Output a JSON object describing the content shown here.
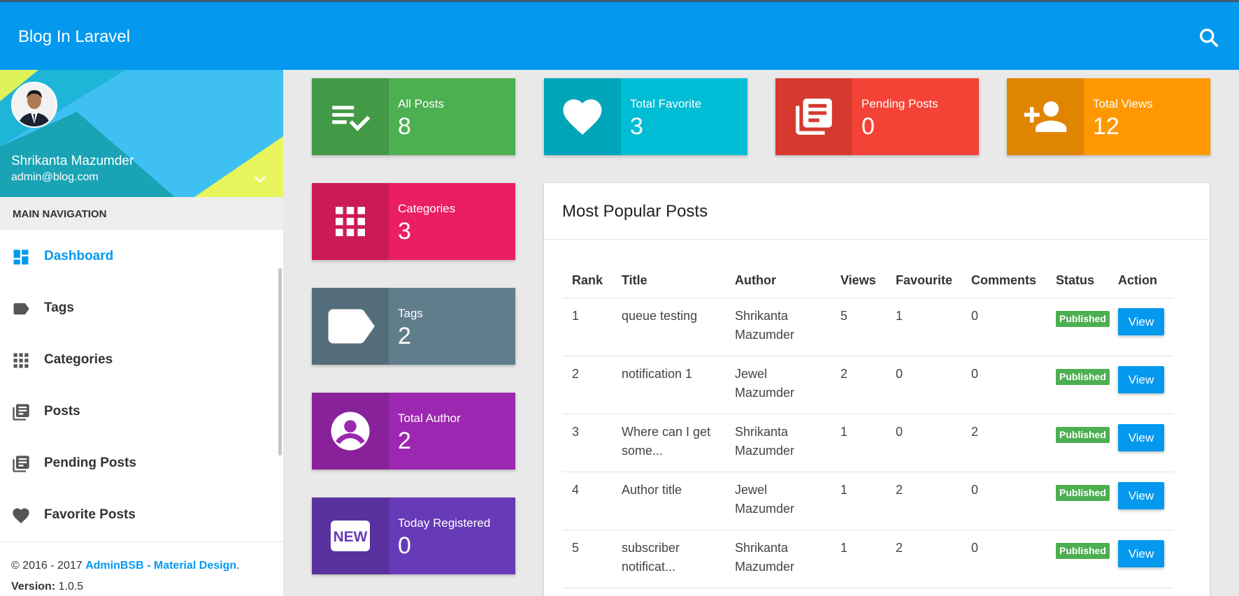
{
  "header": {
    "brand": "Blog In Laravel",
    "search_icon": "search-icon"
  },
  "user": {
    "name": "Shrikanta Mazumder",
    "email": "admin@blog.com"
  },
  "sidebar": {
    "section_header": "MAIN NAVIGATION",
    "items": [
      {
        "label": "Dashboard",
        "icon": "dashboard-icon",
        "active": true
      },
      {
        "label": "Tags",
        "icon": "label-icon",
        "active": false
      },
      {
        "label": "Categories",
        "icon": "apps-grid-icon",
        "active": false
      },
      {
        "label": "Posts",
        "icon": "library-books-icon",
        "active": false
      },
      {
        "label": "Pending Posts",
        "icon": "library-books-icon",
        "active": false
      },
      {
        "label": "Favorite Posts",
        "icon": "heart-icon",
        "active": false
      }
    ],
    "footer": {
      "copyright_prefix": "© 2016 - 2017 ",
      "link": "AdminBSB - Material Design",
      "copyright_suffix": ".",
      "version_label": "Version:",
      "version_value": "1.0.5"
    }
  },
  "stats": [
    {
      "title": "All Posts",
      "value": "8",
      "color": "#4caf50",
      "icon": "playlist-check-icon"
    },
    {
      "title": "Total Favorite",
      "value": "3",
      "color": "#00bcd4",
      "icon": "heart-icon"
    },
    {
      "title": "Pending Posts",
      "value": "0",
      "color": "#f44336",
      "icon": "library-books-icon"
    },
    {
      "title": "Total Views",
      "value": "12",
      "color": "#ff9800",
      "icon": "person-add-icon"
    },
    {
      "title": "Categories",
      "value": "3",
      "color": "#e91e63",
      "icon": "apps-grid-icon"
    },
    {
      "title": "Tags",
      "value": "2",
      "color": "#607d8b",
      "icon": "label-icon"
    },
    {
      "title": "Total Author",
      "value": "2",
      "color": "#9c27b0",
      "icon": "account-circle-icon"
    },
    {
      "title": "Today Registered",
      "value": "0",
      "color": "#673ab7",
      "icon": "new-badge-icon"
    }
  ],
  "popular": {
    "title": "Most Popular Posts",
    "columns": [
      "Rank",
      "Title",
      "Author",
      "Views",
      "Favourite",
      "Comments",
      "Status",
      "Action"
    ],
    "rows": [
      {
        "rank": "1",
        "title": "queue testing",
        "author": "Shrikanta Mazumder",
        "views": "5",
        "fav": "1",
        "comments": "0",
        "status": "Published",
        "action": "View"
      },
      {
        "rank": "2",
        "title": "notification 1",
        "author": "Jewel Mazumder",
        "views": "2",
        "fav": "0",
        "comments": "0",
        "status": "Published",
        "action": "View"
      },
      {
        "rank": "3",
        "title": "Where can I get some...",
        "author": "Shrikanta Mazumder",
        "views": "1",
        "fav": "0",
        "comments": "2",
        "status": "Published",
        "action": "View"
      },
      {
        "rank": "4",
        "title": "Author title",
        "author": "Jewel Mazumder",
        "views": "1",
        "fav": "2",
        "comments": "0",
        "status": "Published",
        "action": "View"
      },
      {
        "rank": "5",
        "title": "subscriber notificat...",
        "author": "Shrikanta Mazumder",
        "views": "1",
        "fav": "2",
        "comments": "0",
        "status": "Published",
        "action": "View"
      }
    ]
  }
}
